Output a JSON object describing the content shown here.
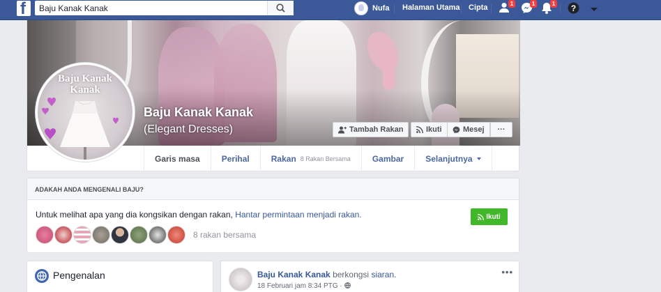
{
  "topbar": {
    "search_value": "Baju Kanak Kanak",
    "user_name": "Nufa",
    "home": "Halaman Utama",
    "create": "Cipta",
    "friend_requests_badge": "1",
    "messages_badge": "1",
    "notifications_badge": "1",
    "colors": {
      "bar": "#3b5998"
    }
  },
  "page": {
    "name": "Baju Kanak Kanak",
    "subtitle": "(Elegant Dresses)",
    "profile_pic_text": [
      "Baju Kanak",
      "Kanak"
    ],
    "actions": {
      "add_friend": "Tambah Rakan",
      "follow": "Ikuti",
      "message": "Mesej",
      "more": "···"
    },
    "tabs": [
      {
        "label": "Garis masa",
        "active": true
      },
      {
        "label": "Perihal"
      },
      {
        "label": "Rakan",
        "count": "8 Rakan Bersama"
      },
      {
        "label": "Gambar"
      },
      {
        "label": "Selanjutnya"
      }
    ]
  },
  "know": {
    "heading": "ADAKAH ANDA MENGENALI BAJU?",
    "text": "Untuk melihat apa yang dia kongsikan dengan rakan,",
    "link": "Hantar permintaan menjadi rakan.",
    "follow": "Ikuti",
    "mutual": "8 rakan bersama",
    "friend_colors": [
      "#c54a6a",
      "#b8202a",
      "#e8a7b7",
      "#6f6a62",
      "#2f3540",
      "#556b46",
      "#444444",
      "#c23a2e"
    ]
  },
  "intro": {
    "title": "Pengenalan"
  },
  "post": {
    "author": "Baju Kanak Kanak",
    "action": "berkongsi",
    "object": "siaran.",
    "time": "18 Februari jam 8:34 PTG",
    "more": "•••"
  }
}
